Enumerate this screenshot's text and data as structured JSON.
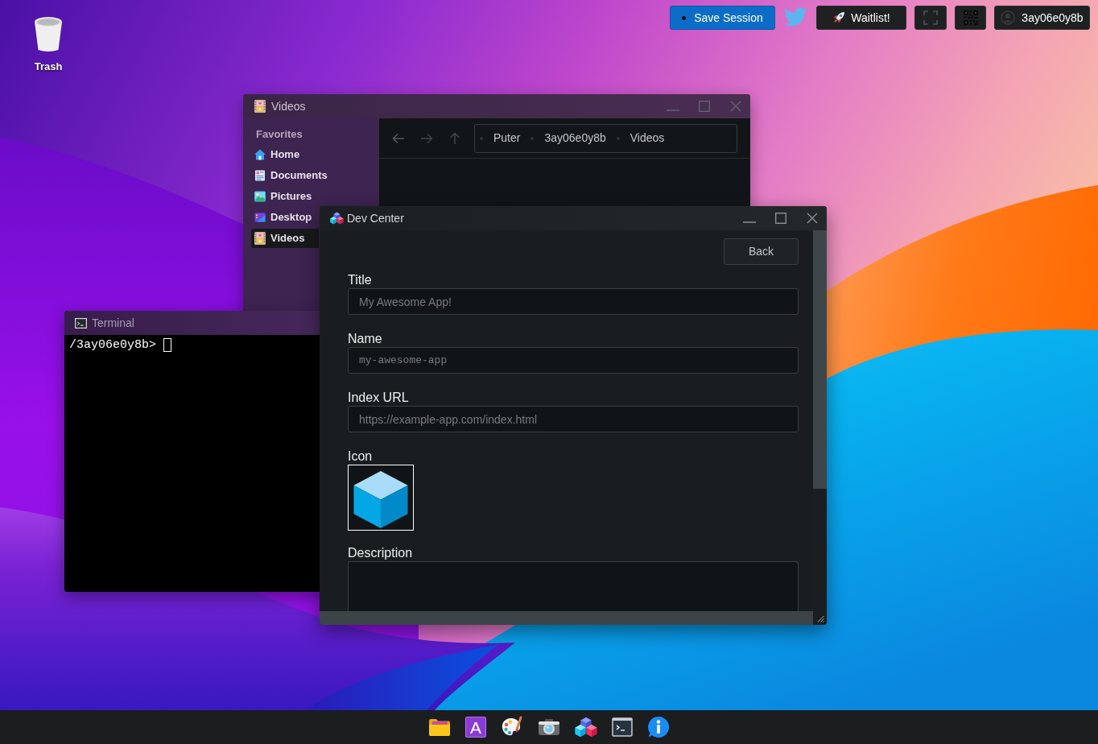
{
  "desktop_icons": [
    {
      "label": "Trash"
    }
  ],
  "top_bar": {
    "save_button": "Save Session",
    "waitlist_button": "Waitlist!",
    "account_button": "3ay06e0y8b"
  },
  "windows": [
    {
      "kind": "explorer",
      "title": "Videos",
      "sidebar": {
        "heading": "Favorites",
        "items": [
          {
            "label": "Home",
            "selected": false
          },
          {
            "label": "Documents",
            "selected": false
          },
          {
            "label": "Pictures",
            "selected": false
          },
          {
            "label": "Desktop",
            "selected": false
          },
          {
            "label": "Videos",
            "selected": true
          }
        ]
      },
      "path": [
        "Puter",
        "3ay06e0y8b",
        "Videos"
      ]
    },
    {
      "kind": "terminal",
      "title": "Terminal",
      "prompt": "/3ay06e0y8b>"
    },
    {
      "kind": "dev_center",
      "title": "Dev Center",
      "back_button": "Back",
      "fields": [
        {
          "kind": "text",
          "label": "Title",
          "placeholder": "My Awesome App!"
        },
        {
          "kind": "code",
          "label": "Name",
          "placeholder": "my-awesome-app"
        },
        {
          "kind": "text",
          "label": "Index URL",
          "placeholder": "https://example-app.com/index.html"
        },
        {
          "kind": "image",
          "label": "Icon"
        },
        {
          "kind": "textarea",
          "label": "Description"
        }
      ]
    }
  ],
  "taskbar": {
    "letter_tile": "A"
  }
}
